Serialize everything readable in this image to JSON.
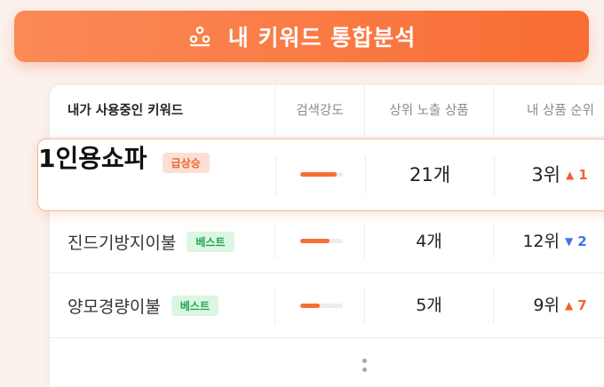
{
  "banner": {
    "title": "내 키워드 통합분석",
    "icon": "people-chart-icon"
  },
  "table": {
    "headers": {
      "keyword": "내가 사용중인 키워드",
      "intensity": "검색강도",
      "products": "상위 노출 상품",
      "rank": "내 상품 순위"
    },
    "rows": [
      {
        "keyword": "1인용쇼파",
        "badge": "급상승",
        "badge_type": "hot",
        "intensity": 0.85,
        "products": "21개",
        "rank": "3위",
        "change": "1",
        "direction": "up"
      },
      {
        "keyword": "진드기방지이불",
        "badge": "베스트",
        "badge_type": "best",
        "intensity": 0.68,
        "products": "4개",
        "rank": "12위",
        "change": "2",
        "direction": "down"
      },
      {
        "keyword": "양모경량이불",
        "badge": "베스트",
        "badge_type": "best",
        "intensity": 0.45,
        "products": "5개",
        "rank": "9위",
        "change": "7",
        "direction": "up"
      }
    ],
    "more_icon": "more-vertical-icon"
  },
  "colors": {
    "accent": "#f86d34",
    "up": "#f0642f",
    "down": "#3f73e8",
    "best": "#23a555"
  }
}
